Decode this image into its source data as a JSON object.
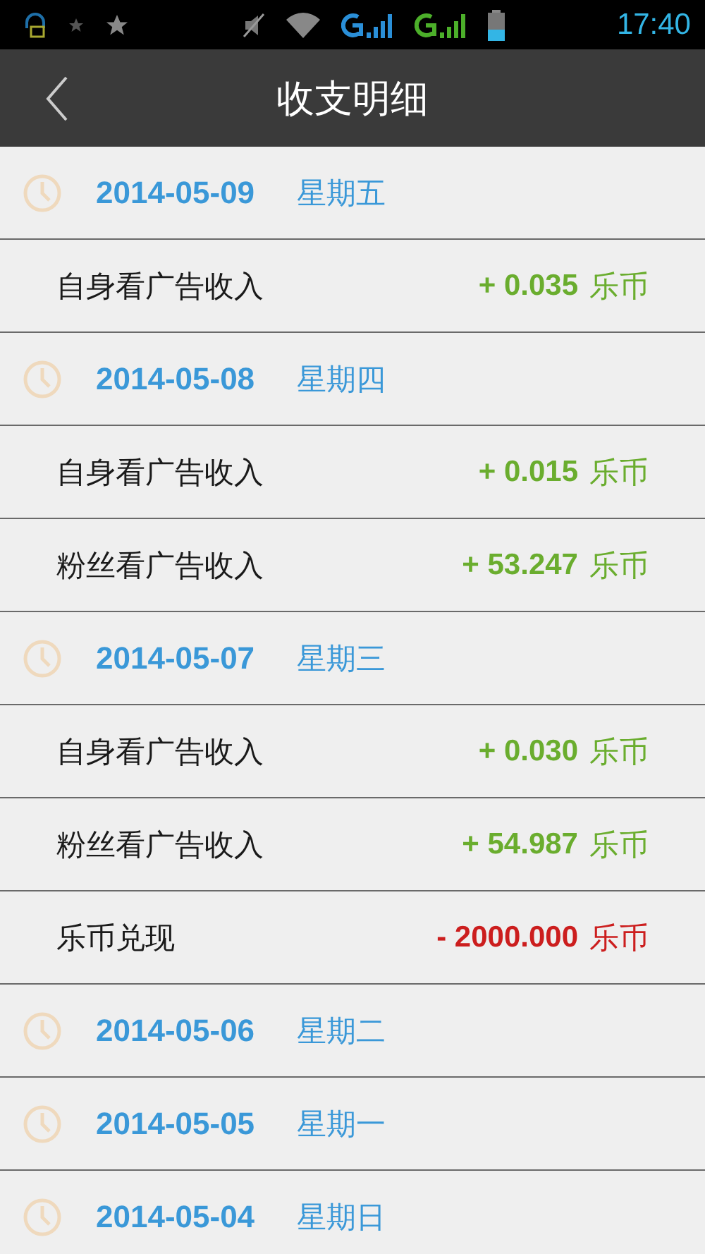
{
  "status_bar": {
    "time": "17:40"
  },
  "header": {
    "title": "收支明细"
  },
  "list": [
    {
      "kind": "date",
      "date": "2014-05-09",
      "weekday": "星期五"
    },
    {
      "kind": "entry",
      "label": "自身看广告收入",
      "amount": "+ 0.035",
      "unit": "乐币",
      "color": "#6aad2e"
    },
    {
      "kind": "date",
      "date": "2014-05-08",
      "weekday": "星期四"
    },
    {
      "kind": "entry",
      "label": "自身看广告收入",
      "amount": "+ 0.015",
      "unit": "乐币",
      "color": "#6aad2e"
    },
    {
      "kind": "entry",
      "label": "粉丝看广告收入",
      "amount": "+ 53.247",
      "unit": "乐币",
      "color": "#6aad2e"
    },
    {
      "kind": "date",
      "date": "2014-05-07",
      "weekday": "星期三"
    },
    {
      "kind": "entry",
      "label": "自身看广告收入",
      "amount": "+ 0.030",
      "unit": "乐币",
      "color": "#6aad2e"
    },
    {
      "kind": "entry",
      "label": "粉丝看广告收入",
      "amount": "+ 54.987",
      "unit": "乐币",
      "color": "#6aad2e"
    },
    {
      "kind": "entry",
      "label": "乐币兑现",
      "amount": "- 2000.000",
      "unit": "乐币",
      "color": "#cc1e1e"
    },
    {
      "kind": "date",
      "date": "2014-05-06",
      "weekday": "星期二"
    },
    {
      "kind": "date",
      "date": "2014-05-05",
      "weekday": "星期一"
    },
    {
      "kind": "date",
      "date": "2014-05-04",
      "weekday": "星期日"
    }
  ]
}
